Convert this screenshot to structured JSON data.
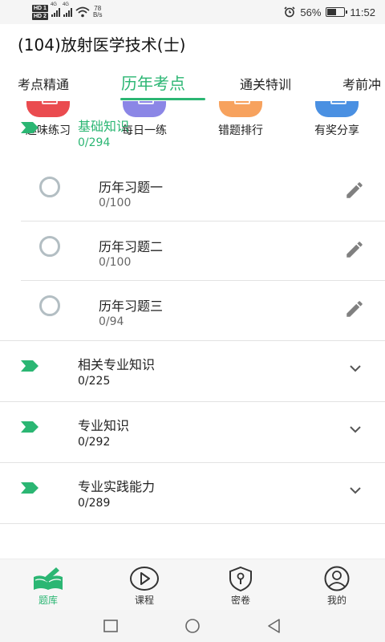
{
  "status_bar": {
    "sim1": "HD 1",
    "sim2": "HD 2",
    "net_type": "4G",
    "net_speed_value": "78",
    "net_speed_unit": "B/s",
    "battery_percent": "56%",
    "battery_level": 0.56,
    "time": "11:52"
  },
  "header": {
    "title": "(104)放射医学技术(士)"
  },
  "tabs": [
    {
      "label": "考点精通",
      "active": false
    },
    {
      "label": "历年考点",
      "active": true
    },
    {
      "label": "通关特训",
      "active": false
    },
    {
      "label": "考前冲",
      "active": false
    }
  ],
  "quick_actions": [
    {
      "label": "趣味练习",
      "color": "#ea4b4f"
    },
    {
      "label": "每日一练",
      "color": "#8b86e6"
    },
    {
      "label": "错题排行",
      "color": "#f7a25e"
    },
    {
      "label": "有奖分享",
      "color": "#4a90e2"
    }
  ],
  "sections": [
    {
      "name": "基础知识",
      "count": "0/294",
      "expanded": true,
      "items": [
        {
          "name": "历年习题一",
          "count": "0/100"
        },
        {
          "name": "历年习题二",
          "count": "0/100"
        },
        {
          "name": "历年习题三",
          "count": "0/94"
        }
      ]
    },
    {
      "name": "相关专业知识",
      "count": "0/225",
      "expanded": false
    },
    {
      "name": "专业知识",
      "count": "0/292",
      "expanded": false
    },
    {
      "name": "专业实践能力",
      "count": "0/289",
      "expanded": false
    }
  ],
  "bottom_nav": [
    {
      "label": "题库",
      "icon": "book-pen-icon",
      "active": true
    },
    {
      "label": "课程",
      "icon": "play-icon",
      "active": false
    },
    {
      "label": "密卷",
      "icon": "shield-lock-icon",
      "active": false
    },
    {
      "label": "我的",
      "icon": "user-icon",
      "active": false
    }
  ],
  "colors": {
    "accent": "#2bb673",
    "divider": "#e2e2e2",
    "radio": "#b3bec3",
    "icon_gray": "#808080"
  }
}
